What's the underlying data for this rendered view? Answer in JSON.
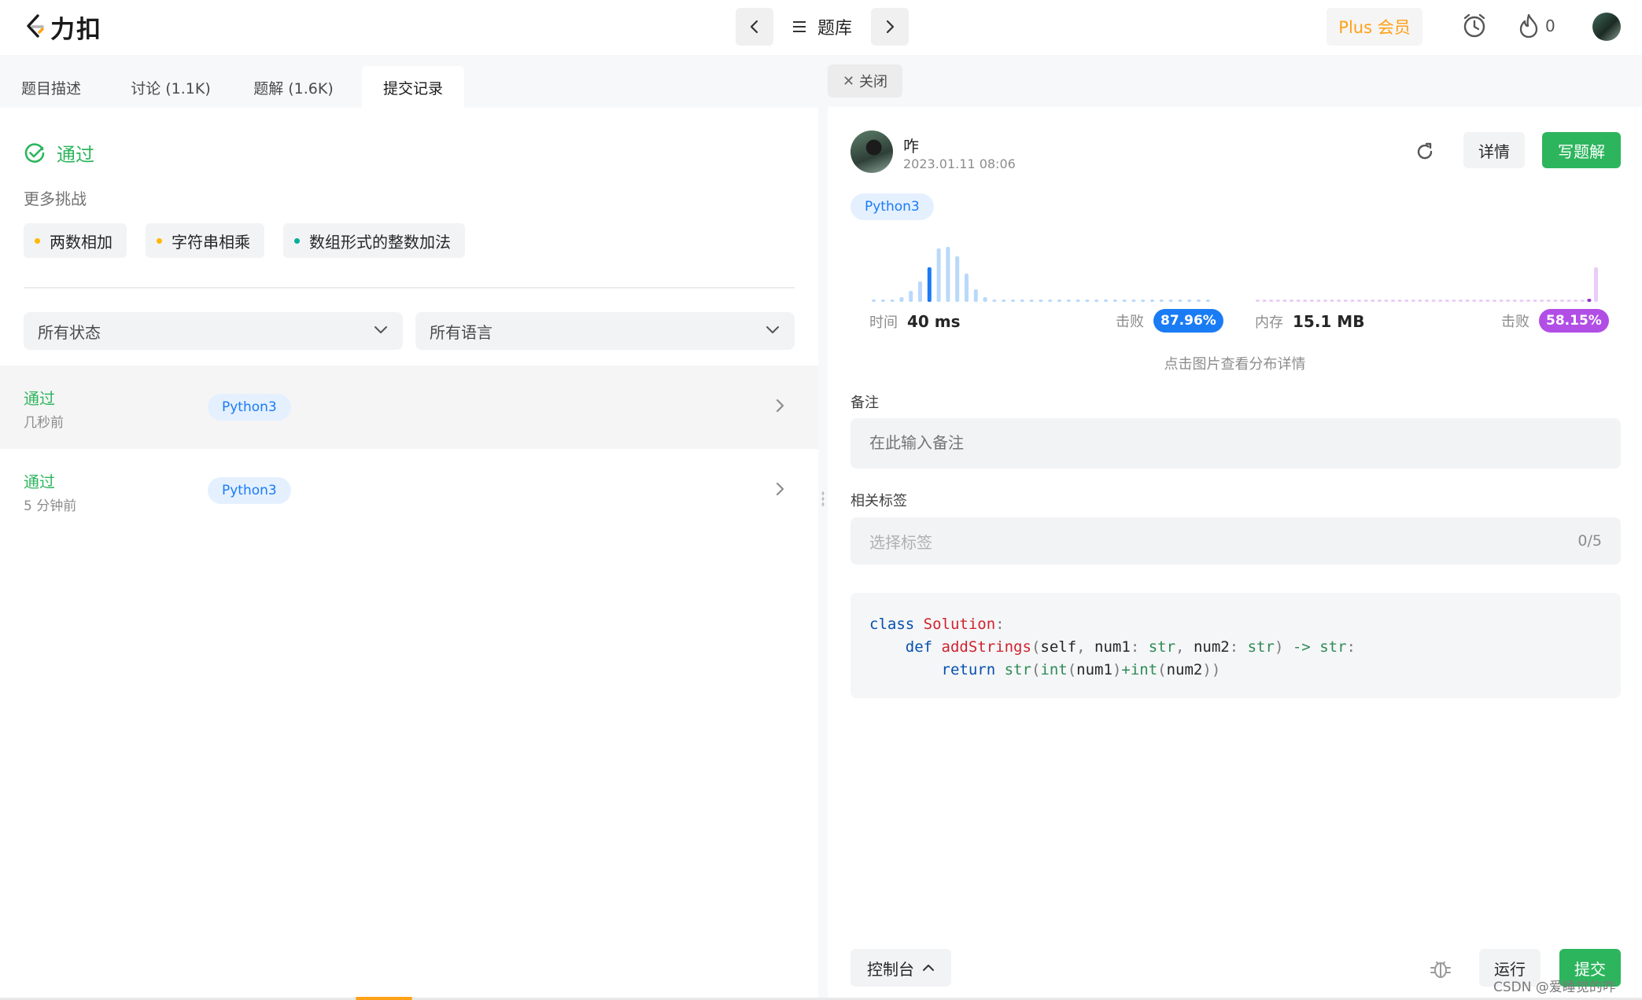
{
  "header": {
    "logo_text": "力扣",
    "nav_title": "题库",
    "plus_label": "Plus 会员",
    "streak_count": "0"
  },
  "left": {
    "tabs": [
      {
        "label": "题目描述",
        "active": false
      },
      {
        "label": "讨论 (1.1K)",
        "active": false
      },
      {
        "label": "题解 (1.6K)",
        "active": false
      },
      {
        "label": "提交记录",
        "active": true
      }
    ],
    "result_status": "通过",
    "more_challenges_label": "更多挑战",
    "challenges": [
      {
        "label": "两数相加",
        "difficulty_color": "#ffb800"
      },
      {
        "label": "字符串相乘",
        "difficulty_color": "#ffb800"
      },
      {
        "label": "数组形式的整数加法",
        "difficulty_color": "#00af9b"
      }
    ],
    "filters": {
      "status": "所有状态",
      "language": "所有语言"
    },
    "submissions": [
      {
        "status": "通过",
        "time": "几秒前",
        "language": "Python3",
        "highlighted": true
      },
      {
        "status": "通过",
        "time": "5 分钟前",
        "language": "Python3",
        "highlighted": false
      }
    ]
  },
  "right": {
    "close_tab_label": "关闭",
    "user_name": "咋",
    "submit_time": "2023.01.11 08:06",
    "detail_label": "详情",
    "write_solution_label": "写题解",
    "language": "Python3",
    "runtime": {
      "label": "时间",
      "value": "40 ms",
      "beats_label": "击败",
      "beats_pct": "87.96%",
      "color": "#1a7cf5"
    },
    "memory": {
      "label": "内存",
      "value": "15.1 MB",
      "beats_label": "击败",
      "beats_pct": "58.15%",
      "color": "#b14ee6"
    },
    "chart_hint": "点击图片查看分布详情",
    "note_label": "备注",
    "note_placeholder": "在此输入备注",
    "tags_label": "相关标签",
    "tags_placeholder": "选择标签",
    "tags_count": "0/5",
    "code_lines": [
      "class Solution:",
      "    def addStrings(self, num1: str, num2: str) -> str:",
      "        return str(int(num1)+int(num2))"
    ],
    "console_label": "控制台",
    "run_label": "运行",
    "submit_label": "提交"
  },
  "watermark": "CSDN @爱睡觉的咋",
  "colors": {
    "accept_green": "#2db55d",
    "brand_orange": "#ffa116",
    "link_blue": "#1a7cf5"
  }
}
